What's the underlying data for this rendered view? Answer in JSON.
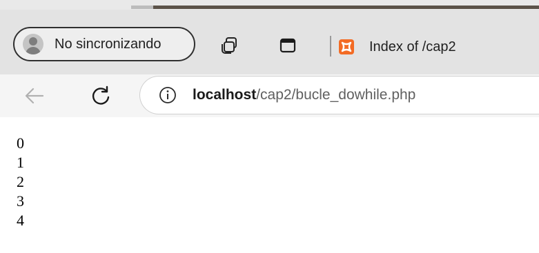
{
  "browser": {
    "profile_label": "No sincronizando",
    "tab": {
      "title": "Index of /cap2",
      "favicon": "xampp-icon"
    },
    "icons": {
      "tabs_icon": "tab-actions-icon",
      "workspaces_icon": "vertical-tabs-icon",
      "back_icon": "back-arrow-icon",
      "reload_icon": "reload-icon",
      "info_icon": "info-icon"
    },
    "address": {
      "host": "localhost",
      "path": "/cap2/bucle_dowhile.php"
    },
    "colors": {
      "favicon_orange": "#f36b24"
    }
  },
  "page": {
    "lines": [
      "0",
      "1",
      "2",
      "3",
      "4"
    ]
  }
}
